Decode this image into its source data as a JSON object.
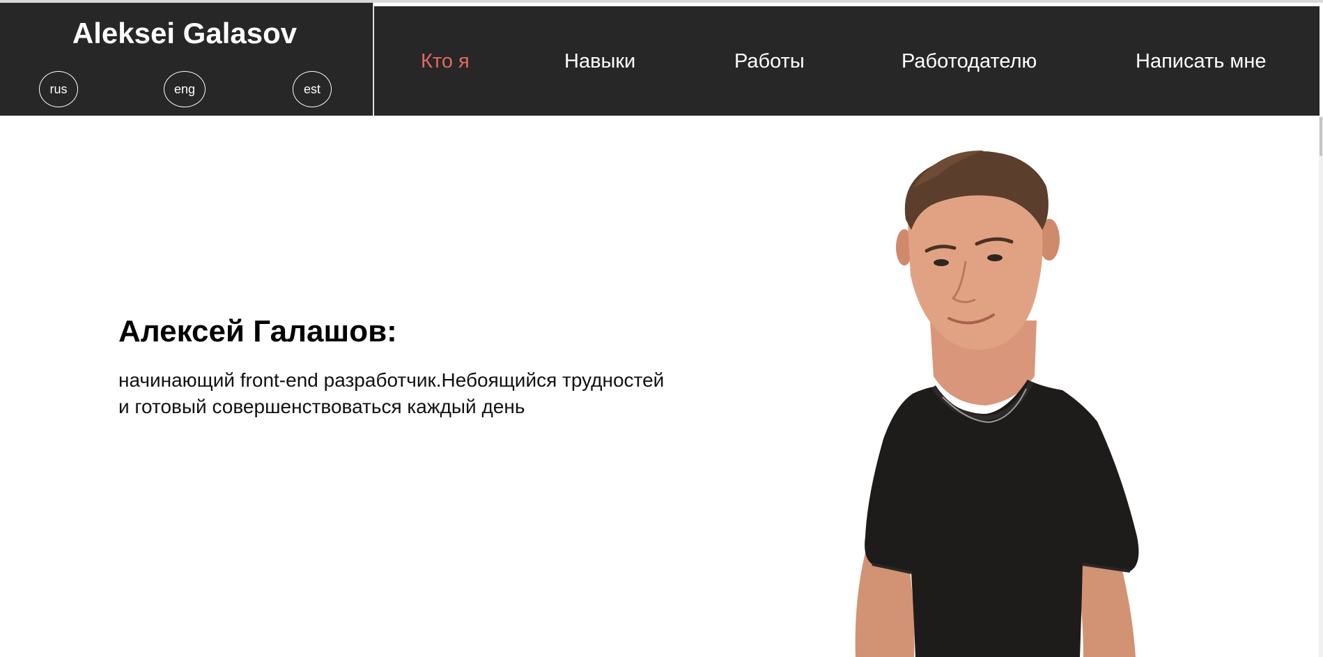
{
  "header": {
    "brand_name": "Aleksei Galasov",
    "languages": [
      {
        "label": "rus"
      },
      {
        "label": "eng"
      },
      {
        "label": "est"
      }
    ]
  },
  "nav": {
    "items": [
      {
        "label": "Кто я",
        "active": true
      },
      {
        "label": "Навыки",
        "active": false
      },
      {
        "label": "Работы",
        "active": false
      },
      {
        "label": "Работодателю",
        "active": false
      },
      {
        "label": "Написать мне",
        "active": false
      }
    ]
  },
  "hero": {
    "heading": "Алексей Галашов:",
    "description": "начинающий front-end разработчик.Небоящийся трудностей и готовый совершенствоваться каждый день",
    "photo_icon": "person-portrait-icon"
  },
  "colors": {
    "header_bg": "#272727",
    "active_nav": "#e06a5f",
    "text_light": "#ffffff",
    "page_bg": "#ffffff"
  }
}
